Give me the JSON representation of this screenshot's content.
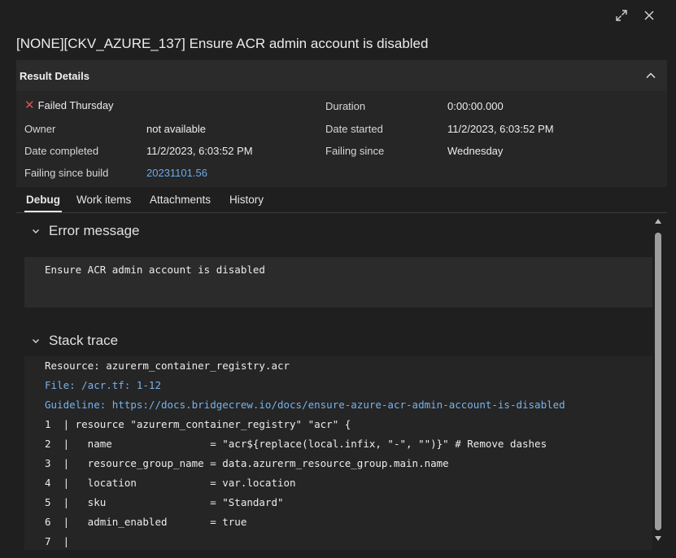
{
  "title": "[NONE][CKV_AZURE_137] Ensure ACR admin account is disabled",
  "result_details": {
    "header": "Result Details",
    "status": "Failed Thursday",
    "owner_label": "Owner",
    "owner_value": "not available",
    "date_completed_label": "Date completed",
    "date_completed_value": "11/2/2023, 6:03:52 PM",
    "failing_since_build_label": "Failing since build",
    "failing_since_build_value": "20231101.56",
    "duration_label": "Duration",
    "duration_value": "0:00:00.000",
    "date_started_label": "Date started",
    "date_started_value": "11/2/2023, 6:03:52 PM",
    "failing_since_label": "Failing since",
    "failing_since_value": "Wednesday"
  },
  "tabs": [
    {
      "label": "Debug",
      "active": true
    },
    {
      "label": "Work items",
      "active": false
    },
    {
      "label": "Attachments",
      "active": false
    },
    {
      "label": "History",
      "active": false
    }
  ],
  "error_message": {
    "header": "Error message",
    "text": "Ensure ACR admin account is disabled"
  },
  "stack_trace": {
    "header": "Stack trace",
    "resource": "Resource: azurerm_container_registry.acr",
    "file": "File: /acr.tf: 1-12",
    "guideline": "Guideline: https://docs.bridgecrew.io/docs/ensure-azure-acr-admin-account-is-disabled",
    "code_lines": [
      "1  | resource \"azurerm_container_registry\" \"acr\" {",
      "2  |   name                = \"acr${replace(local.infix, \"-\", \"\")}\" # Remove dashes",
      "3  |   resource_group_name = data.azurerm_resource_group.main.name",
      "4  |   location            = var.location",
      "5  |   sku                 = \"Standard\"",
      "6  |   admin_enabled       = true",
      "7  |"
    ]
  },
  "icons": {
    "expand": "expand-icon",
    "close": "close-icon",
    "collapse": "chevron-up-icon",
    "status": "fail-x-icon"
  },
  "colors": {
    "background": "#1f1f1f",
    "link": "#6ba9ec",
    "fail": "#e0524f"
  }
}
